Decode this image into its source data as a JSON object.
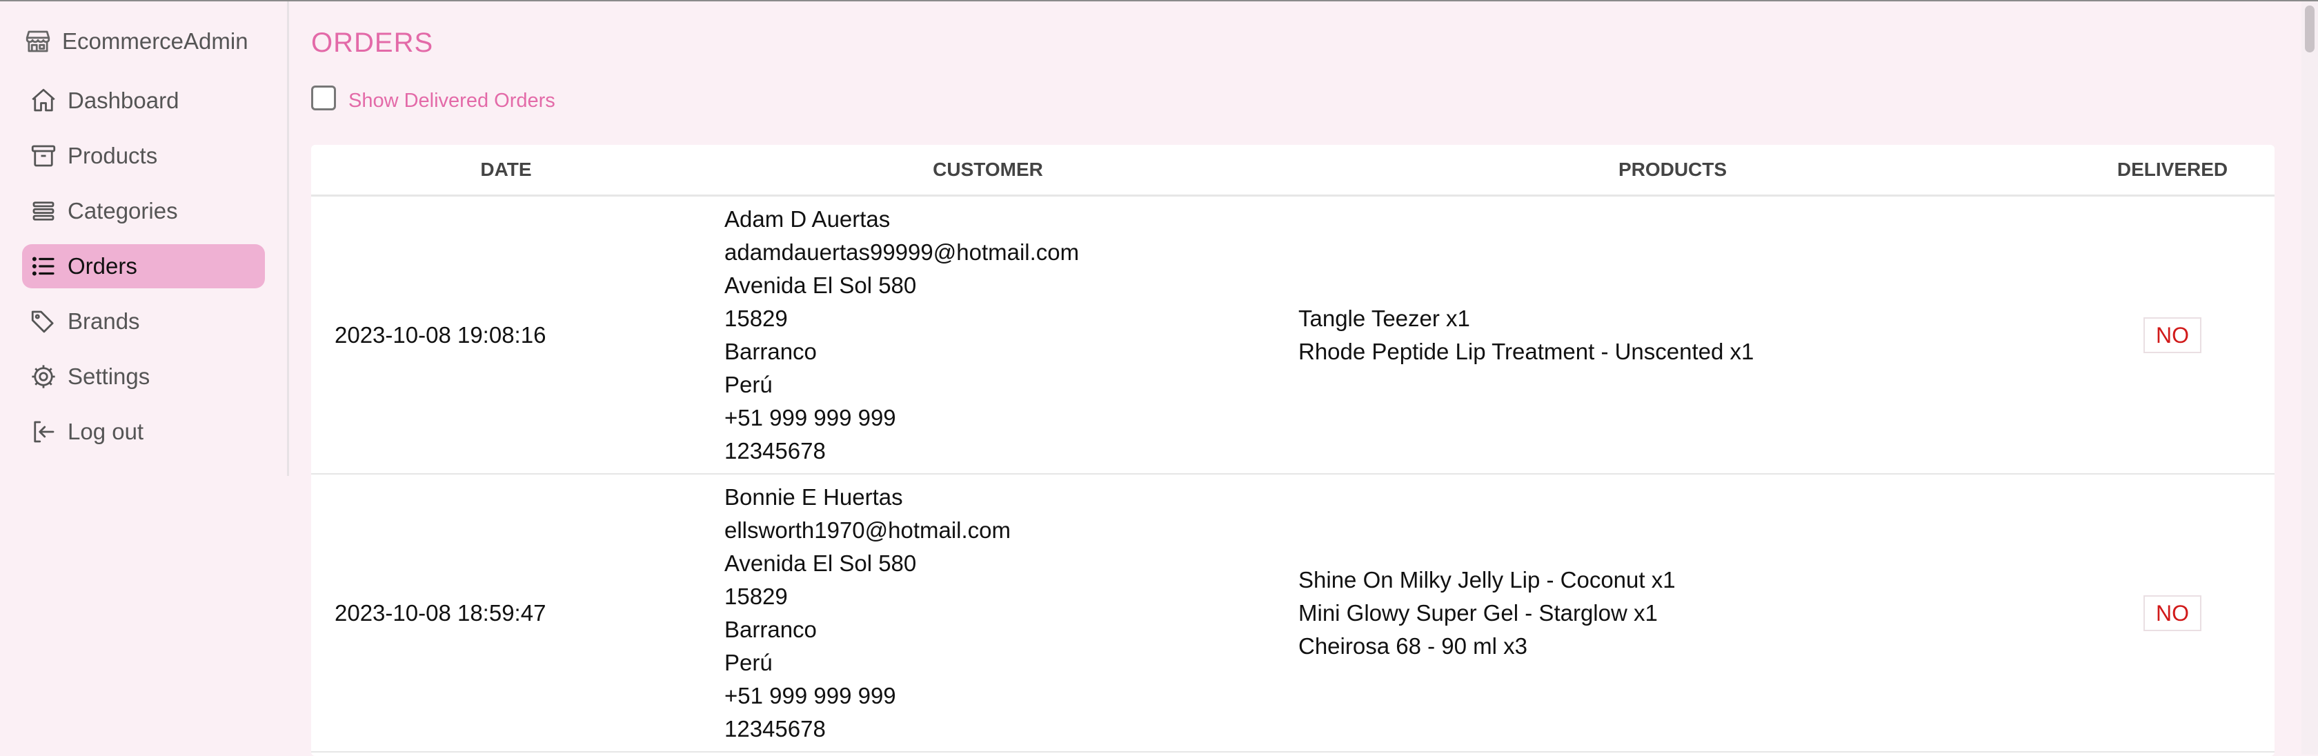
{
  "app": {
    "name": "EcommerceAdmin"
  },
  "sidebar": {
    "items": [
      {
        "label": "Dashboard",
        "icon": "home-icon",
        "active": false
      },
      {
        "label": "Products",
        "icon": "archive-box-icon",
        "active": false
      },
      {
        "label": "Categories",
        "icon": "stack-icon",
        "active": false
      },
      {
        "label": "Orders",
        "icon": "list-icon",
        "active": true
      },
      {
        "label": "Brands",
        "icon": "tag-icon",
        "active": false
      },
      {
        "label": "Settings",
        "icon": "gear-icon",
        "active": false
      },
      {
        "label": "Log out",
        "icon": "logout-icon",
        "active": false
      }
    ]
  },
  "page": {
    "title": "ORDERS",
    "filter_label": "Show Delivered Orders",
    "filter_checked": false
  },
  "table": {
    "headers": {
      "date": "DATE",
      "customer": "CUSTOMER",
      "products": "PRODUCTS",
      "delivered": "DELIVERED"
    },
    "rows": [
      {
        "date": "2023-10-08 19:08:16",
        "customer": {
          "name": "Adam D Auertas",
          "email": "adamdauertas99999@hotmail.com",
          "address": "Avenida El Sol 580",
          "postal": "15829",
          "city": "Barranco",
          "country": "Perú",
          "phone": "+51 999 999 999",
          "doc": "12345678"
        },
        "products": [
          "Tangle Teezer x1",
          "Rhode Peptide Lip Treatment - Unscented x1"
        ],
        "delivered": "NO"
      },
      {
        "date": "2023-10-08 18:59:47",
        "customer": {
          "name": "Bonnie E Huertas",
          "email": "ellsworth1970@hotmail.com",
          "address": "Avenida El Sol 580",
          "postal": "15829",
          "city": "Barranco",
          "country": "Perú",
          "phone": "+51 999 999 999",
          "doc": "12345678"
        },
        "products": [
          "Shine On Milky Jelly Lip - Coconut x1",
          "Mini Glowy Super Gel - Starglow x1",
          "Cheirosa 68 - 90 ml x3"
        ],
        "delivered": "NO"
      }
    ]
  },
  "colors": {
    "accent": "#e36aa8",
    "active_bg": "#efb1d3",
    "background": "#fbf0f5",
    "danger": "#d11a1a"
  }
}
